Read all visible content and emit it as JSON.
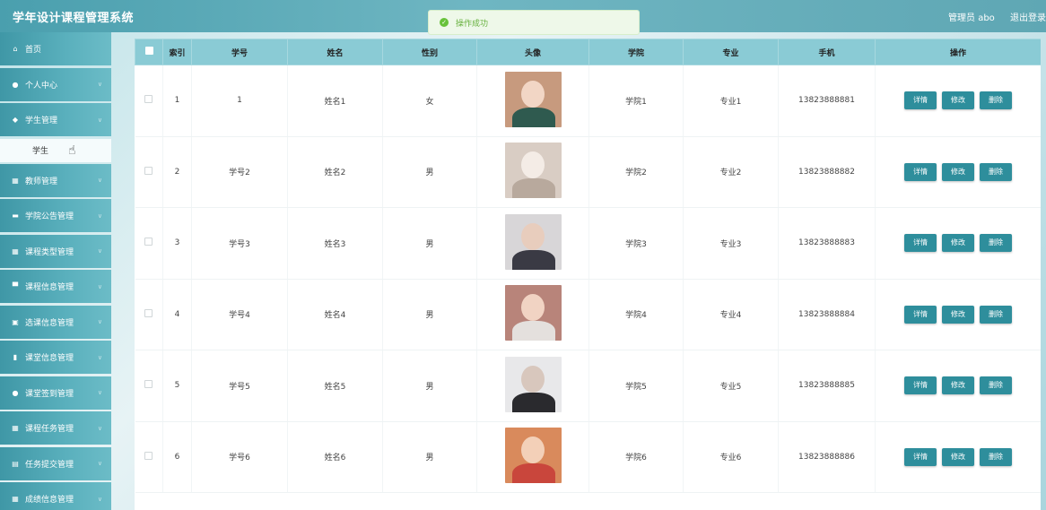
{
  "app": {
    "title": "学年设计课程管理系统",
    "user": "管理员 abo",
    "logout": "退出登录"
  },
  "toast": {
    "message": "操作成功"
  },
  "sidebar": {
    "items": [
      {
        "label": "首页",
        "icon": "home-icon",
        "glyph": "⌂",
        "chevron": false
      },
      {
        "label": "个人中心",
        "icon": "user-icon",
        "glyph": "●",
        "chevron": true
      },
      {
        "label": "学生管理",
        "icon": "location-icon",
        "glyph": "◆",
        "chevron": true
      },
      {
        "label": "教师管理",
        "icon": "grid-icon",
        "glyph": "▦",
        "chevron": true
      },
      {
        "label": "学院公告管理",
        "icon": "box-icon",
        "glyph": "▬",
        "chevron": true
      },
      {
        "label": "课程类型管理",
        "icon": "grid-icon",
        "glyph": "▦",
        "chevron": true
      },
      {
        "label": "课程信息管理",
        "icon": "monitor-icon",
        "glyph": "▀",
        "chevron": true
      },
      {
        "label": "选课信息管理",
        "icon": "clipboard-icon",
        "glyph": "▣",
        "chevron": true
      },
      {
        "label": "课堂信息管理",
        "icon": "bar-chart-icon",
        "glyph": "▮",
        "chevron": true
      },
      {
        "label": "课堂签到管理",
        "icon": "user-icon",
        "glyph": "●",
        "chevron": true
      },
      {
        "label": "课程任务管理",
        "icon": "grid-icon",
        "glyph": "▦",
        "chevron": true
      },
      {
        "label": "任务提交管理",
        "icon": "document-icon",
        "glyph": "▤",
        "chevron": true
      },
      {
        "label": "成绩信息管理",
        "icon": "grid-icon",
        "glyph": "▦",
        "chevron": true
      }
    ],
    "submenu": {
      "label": "学生"
    }
  },
  "table": {
    "columns": [
      "索引",
      "学号",
      "姓名",
      "性别",
      "头像",
      "学院",
      "专业",
      "手机",
      "操作"
    ],
    "actions": {
      "detail": "详情",
      "edit": "修改",
      "delete": "删除"
    },
    "rows": [
      {
        "index": "1",
        "id": "1",
        "name": "姓名1",
        "gender": "女",
        "college": "学院1",
        "major": "专业1",
        "phone": "13823888881"
      },
      {
        "index": "2",
        "id": "学号2",
        "name": "姓名2",
        "gender": "男",
        "college": "学院2",
        "major": "专业2",
        "phone": "13823888882"
      },
      {
        "index": "3",
        "id": "学号3",
        "name": "姓名3",
        "gender": "男",
        "college": "学院3",
        "major": "专业3",
        "phone": "13823888883"
      },
      {
        "index": "4",
        "id": "学号4",
        "name": "姓名4",
        "gender": "男",
        "college": "学院4",
        "major": "专业4",
        "phone": "13823888884"
      },
      {
        "index": "5",
        "id": "学号5",
        "name": "姓名5",
        "gender": "男",
        "college": "学院5",
        "major": "专业5",
        "phone": "13823888885"
      },
      {
        "index": "6",
        "id": "学号6",
        "name": "姓名6",
        "gender": "男",
        "college": "学院6",
        "major": "专业6",
        "phone": "13823888886"
      }
    ],
    "avatar_colors": [
      {
        "bg": "#c79a7e",
        "face": "#f2d6c5",
        "body": "#2f5a4f"
      },
      {
        "bg": "#d9cdc4",
        "face": "#f4ece6",
        "body": "#b8a99d"
      },
      {
        "bg": "#d8d6d8",
        "face": "#e8cdbd",
        "body": "#3a3a44"
      },
      {
        "bg": "#b8847a",
        "face": "#f1d3c3",
        "body": "#e4e0dd"
      },
      {
        "bg": "#e8e8ea",
        "face": "#d8c7bd",
        "body": "#2a2a2e"
      },
      {
        "bg": "#d98a5c",
        "face": "#f3d0b8",
        "body": "#c9463c"
      }
    ]
  }
}
